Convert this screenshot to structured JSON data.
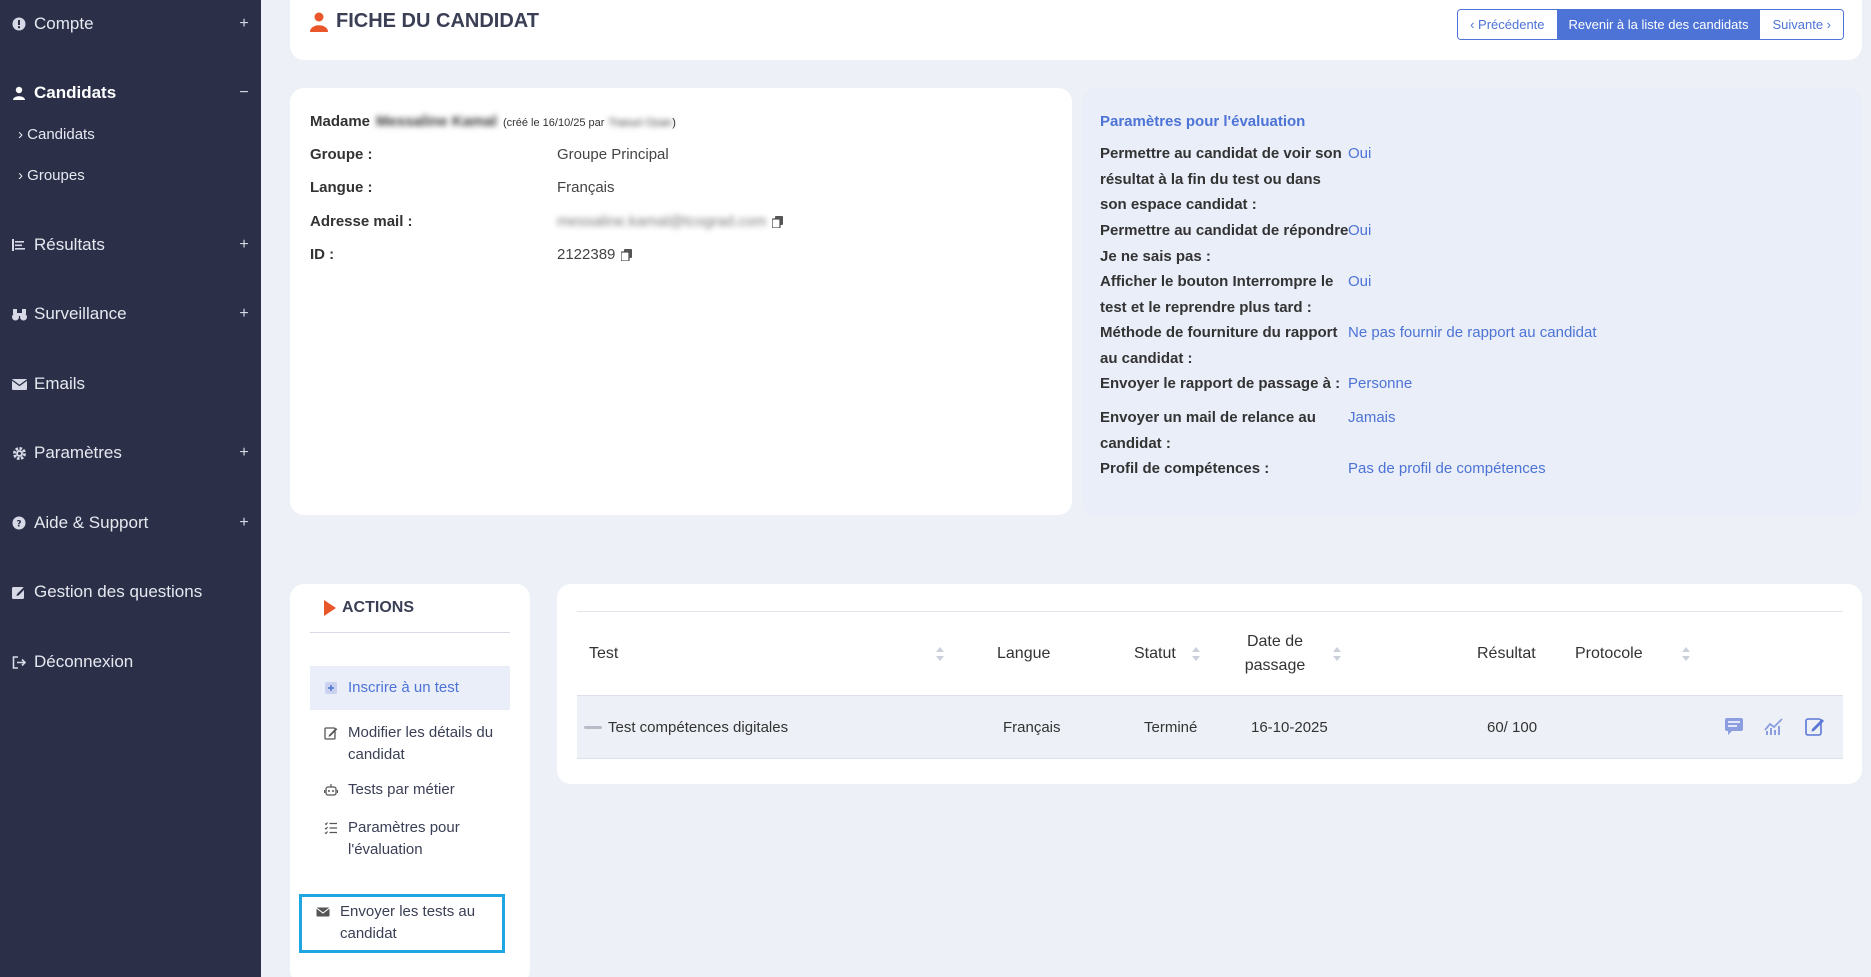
{
  "sidebar": {
    "items": [
      {
        "label": "Compte",
        "toggle": "+"
      },
      {
        "label": "Candidats",
        "toggle": "−"
      },
      {
        "label": "Résultats",
        "toggle": "+"
      },
      {
        "label": "Surveillance",
        "toggle": "+"
      },
      {
        "label": "Emails",
        "toggle": ""
      },
      {
        "label": "Paramètres",
        "toggle": "+"
      },
      {
        "label": "Aide & Support",
        "toggle": "+"
      },
      {
        "label": "Gestion des questions",
        "toggle": ""
      },
      {
        "label": "Déconnexion",
        "toggle": ""
      }
    ],
    "subitems": [
      "› Candidats",
      "› Groupes"
    ]
  },
  "header": {
    "title": "FICHE DU CANDIDAT",
    "prev": "‹  Précédente",
    "back": "Revenir à la liste des candidats",
    "next": "Suivante  ›"
  },
  "candidate": {
    "civility": "Madame",
    "name": "Messaline Kamal",
    "created_prefix": "(créé le 16/10/25 par",
    "created_by": "Tranuri Ozan",
    "created_suffix": ")",
    "group_label": "Groupe :",
    "group_value": "Groupe Principal",
    "lang_label": "Langue :",
    "lang_value": "Français",
    "email_label": "Adresse mail :",
    "email_value": "messaline.kamal@tcograd.com",
    "id_label": "ID :",
    "id_value": "2122389"
  },
  "params": {
    "title": "Paramètres pour l'évaluation",
    "rows": [
      {
        "key": "Permettre au candidat de voir son résultat à la fin du test ou dans son espace candidat :",
        "value": "Oui"
      },
      {
        "key": "Permettre au candidat de répondre Je ne sais pas :",
        "value": "Oui"
      },
      {
        "key": "Afficher le bouton Interrompre le test et le reprendre plus tard :",
        "value": "Oui"
      },
      {
        "key": "Méthode de fourniture du rapport au candidat :",
        "value": "Ne pas fournir de rapport au candidat"
      },
      {
        "key": "Envoyer le rapport de passage à :",
        "value": "Personne"
      },
      {
        "key": "Envoyer un mail de relance au candidat :",
        "value": "Jamais"
      },
      {
        "key": "Profil de compétences :",
        "value": "Pas de profil de compétences"
      }
    ]
  },
  "actions": {
    "title": "ACTIONS",
    "items": [
      "Inscrire à un test",
      "Modifier les détails du candidat",
      "Tests par métier",
      "Paramètres pour l'évaluation",
      "Envoyer les tests au candidat"
    ]
  },
  "table": {
    "headers": [
      "Test",
      "Langue",
      "Statut",
      "Date de passage",
      "Résultat",
      "Protocole"
    ],
    "rows": [
      {
        "test": "Test compétences digitales",
        "langue": "Français",
        "statut": "Terminé",
        "date": "16-10-2025",
        "resultat": "60/ 100",
        "protocole": ""
      }
    ]
  },
  "colors": {
    "sidebar_bg": "#2b3048",
    "accent": "#4d73d6",
    "highlight_border": "#1ea6e0",
    "orange": "#e8562a"
  }
}
